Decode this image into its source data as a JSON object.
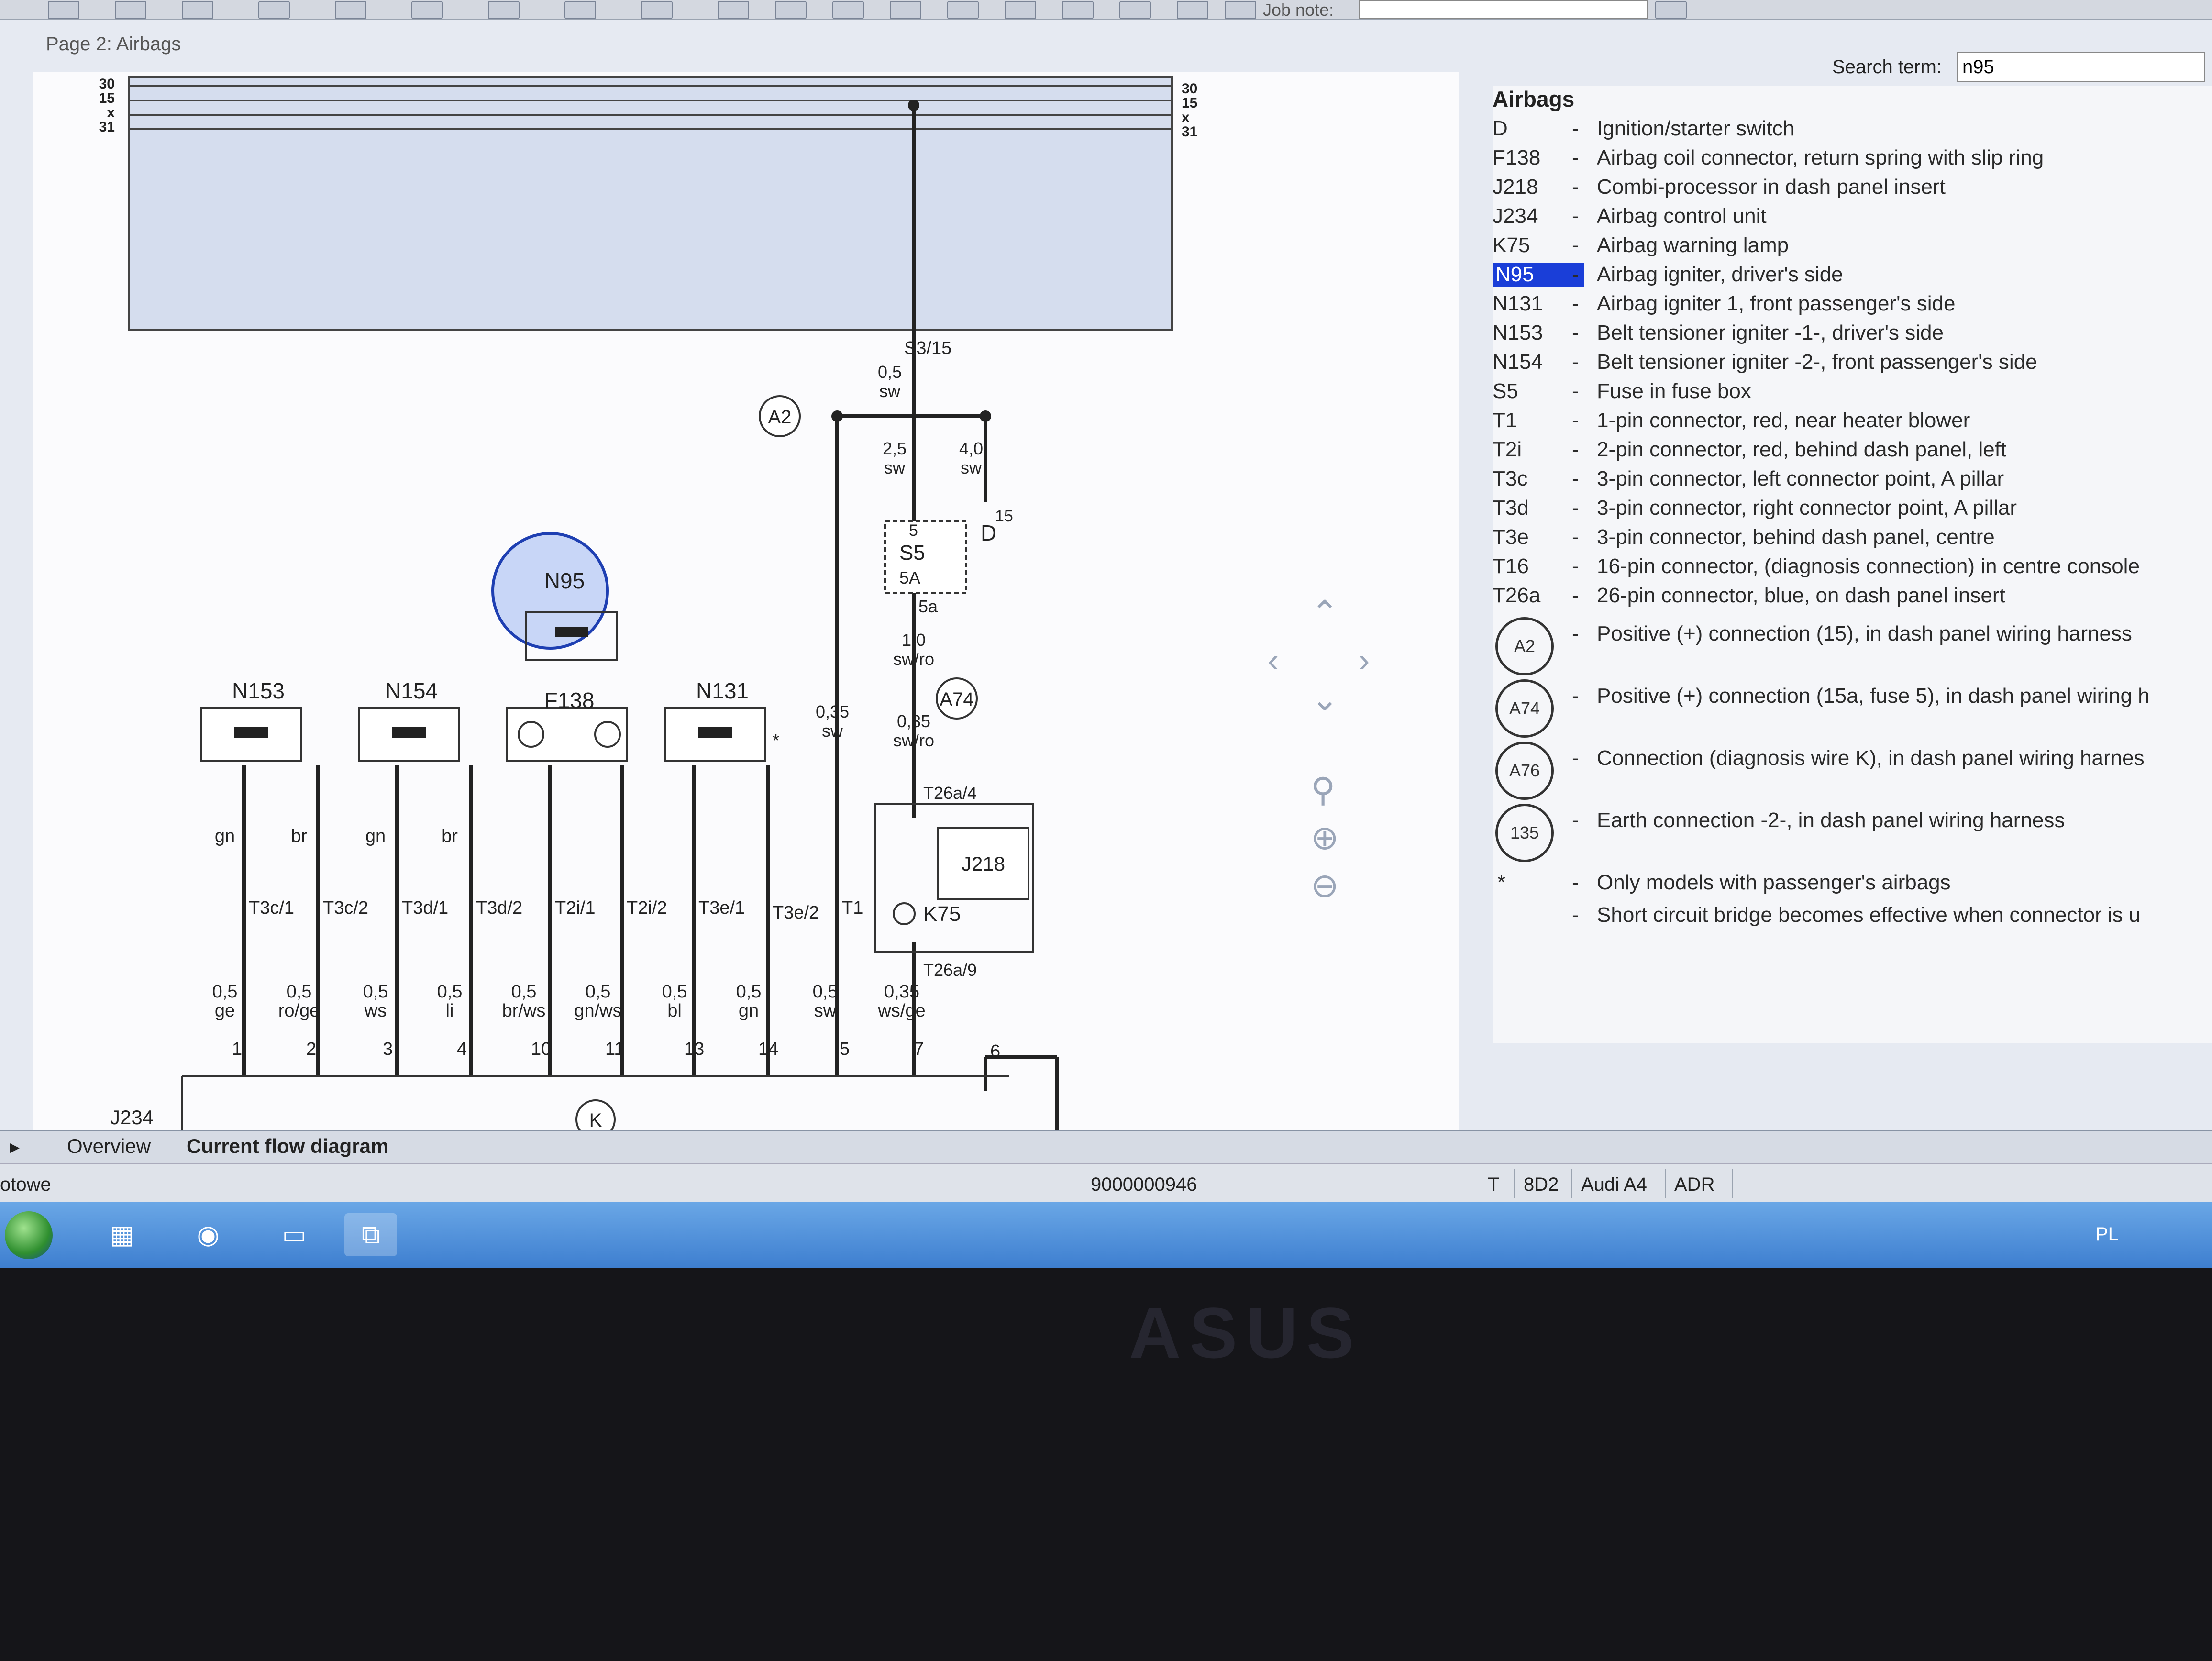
{
  "toolbar": {
    "job_note_label": "Job note:"
  },
  "page": {
    "title": "Page 2: Airbags"
  },
  "search": {
    "label": "Search term:",
    "value": "n95"
  },
  "legend": {
    "title": "Airbags",
    "items": [
      {
        "code": "D",
        "desc": "Ignition/starter switch"
      },
      {
        "code": "F138",
        "desc": "Airbag coil connector, return spring with slip ring"
      },
      {
        "code": "J218",
        "desc": "Combi-processor in dash panel insert"
      },
      {
        "code": "J234",
        "desc": "Airbag control unit"
      },
      {
        "code": "K75",
        "desc": "Airbag warning lamp"
      },
      {
        "code": "N95",
        "desc": "Airbag igniter, driver's side"
      },
      {
        "code": "N131",
        "desc": "Airbag igniter 1, front passenger's side"
      },
      {
        "code": "N153",
        "desc": "Belt tensioner igniter -1-, driver's side"
      },
      {
        "code": "N154",
        "desc": "Belt tensioner igniter -2-, front passenger's side"
      },
      {
        "code": "S5",
        "desc": "Fuse in fuse box"
      },
      {
        "code": "T1",
        "desc": "1-pin connector, red, near heater blower"
      },
      {
        "code": "T2i",
        "desc": "2-pin connector, red, behind dash panel, left"
      },
      {
        "code": "T3c",
        "desc": "3-pin connector, left connector point, A pillar"
      },
      {
        "code": "T3d",
        "desc": "3-pin connector, right connector point, A pillar"
      },
      {
        "code": "T3e",
        "desc": "3-pin connector, behind dash panel, centre"
      },
      {
        "code": "T16",
        "desc": "16-pin connector, (diagnosis connection) in centre console"
      },
      {
        "code": "T26a",
        "desc": "26-pin connector, blue, on dash panel insert"
      }
    ],
    "circle_items": [
      {
        "code": "A2",
        "desc": "Positive (+) connection (15), in dash panel wiring harness"
      },
      {
        "code": "A74",
        "desc": "Positive (+) connection (15a, fuse 5), in dash panel wiring h"
      },
      {
        "code": "A76",
        "desc": "Connection (diagnosis wire K), in dash panel wiring harnes"
      },
      {
        "code": "135",
        "desc": "Earth connection -2-, in dash panel wiring harness"
      }
    ],
    "notes": [
      {
        "code": "*",
        "desc": "Only models with passenger's airbags"
      },
      {
        "code": "",
        "desc": "Short circuit bridge becomes effective when connector is u"
      }
    ],
    "highlight_code": "N95",
    "highlight_color": "#1a3ed8"
  },
  "diagram": {
    "bus_labels": [
      "30",
      "15",
      "x",
      "31"
    ],
    "components": {
      "n153": "N153",
      "n154": "N154",
      "n95": "N95",
      "f138": "F138",
      "n131": "N131",
      "s5": "S5",
      "fuse_value": "5A",
      "d": "D",
      "j218": "J218",
      "k75": "K75",
      "j234": "J234",
      "a2": "A2",
      "a74": "A74",
      "k": "K"
    },
    "top_terminal": "S3/15",
    "fuse_pins": {
      "in": "5",
      "out": "5a"
    },
    "d_pin": "15",
    "wires_upper": [
      {
        "size": "0,5",
        "color": "sw"
      },
      {
        "size": "2,5",
        "color": "sw"
      },
      {
        "size": "4,0",
        "color": "sw"
      },
      {
        "size": "1,0",
        "color": "sw/ro"
      },
      {
        "size": "0,35",
        "color": "sw/ro"
      },
      {
        "size": "0,35",
        "color": "sw"
      }
    ],
    "pin_colors": [
      "gn",
      "br",
      "gn",
      "br"
    ],
    "connectors": [
      "T3c/1",
      "T3c/2",
      "T3d/1",
      "T3d/2",
      "T2i/1",
      "T2i/2",
      "T3e/1",
      "T3e/2",
      "T1",
      "T26a/4",
      "T26a/9"
    ],
    "bottom_wires": [
      {
        "size": "0,5",
        "color": "ge",
        "pin": "1"
      },
      {
        "size": "0,5",
        "color": "ro/ge",
        "pin": "2"
      },
      {
        "size": "0,5",
        "color": "ws",
        "pin": "3"
      },
      {
        "size": "0,5",
        "color": "li",
        "pin": "4"
      },
      {
        "size": "0,5",
        "color": "br/ws",
        "pin": "10"
      },
      {
        "size": "0,5",
        "color": "gn/ws",
        "pin": "11"
      },
      {
        "size": "0,5",
        "color": "bl",
        "pin": "13"
      },
      {
        "size": "0,5",
        "color": "gn",
        "pin": "14"
      },
      {
        "size": "0,5",
        "color": "sw",
        "pin": "5"
      },
      {
        "size": "0,35",
        "color": "ws/ge",
        "pin": "7"
      }
    ],
    "extra_pin": "6",
    "asterisk": "*"
  },
  "tabs": {
    "overview": "Overview",
    "current": "Current flow diagram"
  },
  "status": {
    "left": "otowe",
    "number": "9000000946",
    "type": "T",
    "code": "8D2",
    "model": "Audi A4",
    "engine": "ADR"
  },
  "taskbar": {
    "tray_lang": "PL"
  },
  "bezel": {
    "brand": "ASUS"
  },
  "icons": [
    "nav-up-icon",
    "nav-left-icon",
    "nav-right-icon",
    "nav-down-icon",
    "zoom-icon",
    "zoom-in-icon",
    "zoom-out-icon",
    "start-orb-icon",
    "chrome-icon",
    "explorer-icon"
  ]
}
